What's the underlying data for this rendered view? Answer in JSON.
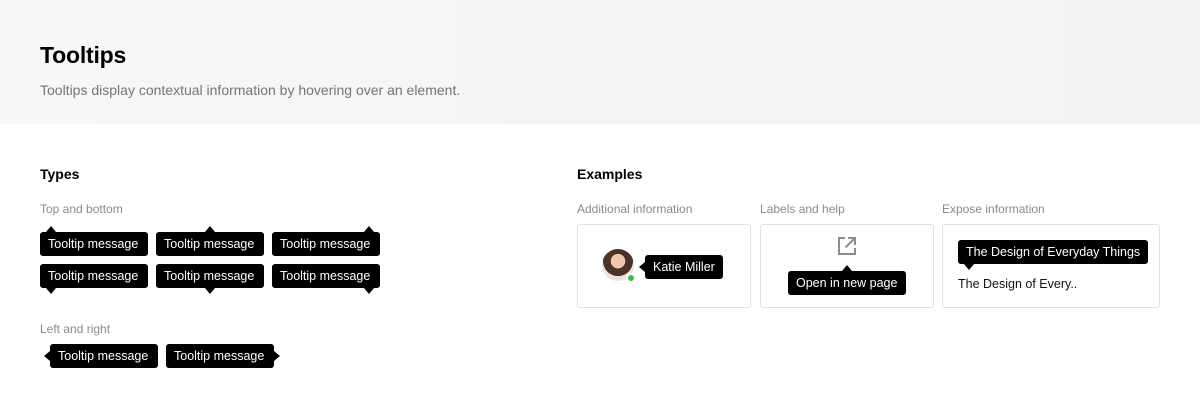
{
  "header": {
    "title": "Tooltips",
    "subtitle": "Tooltips display contextual information by hovering over an element."
  },
  "types": {
    "title": "Types",
    "top_bottom_label": "Top and bottom",
    "left_right_label": "Left and right",
    "tooltip_text": "Tooltip message"
  },
  "examples": {
    "title": "Examples",
    "additional_info": {
      "label": "Additional information",
      "tooltip": "Katie Miller",
      "status_color": "#3dbb48"
    },
    "labels_help": {
      "label": "Labels and help",
      "tooltip": "Open in new page",
      "icon": "open-in-new-icon"
    },
    "expose_info": {
      "label": "Expose information",
      "tooltip": "The Design of Everyday Things",
      "text": "The Design of Every.."
    }
  }
}
